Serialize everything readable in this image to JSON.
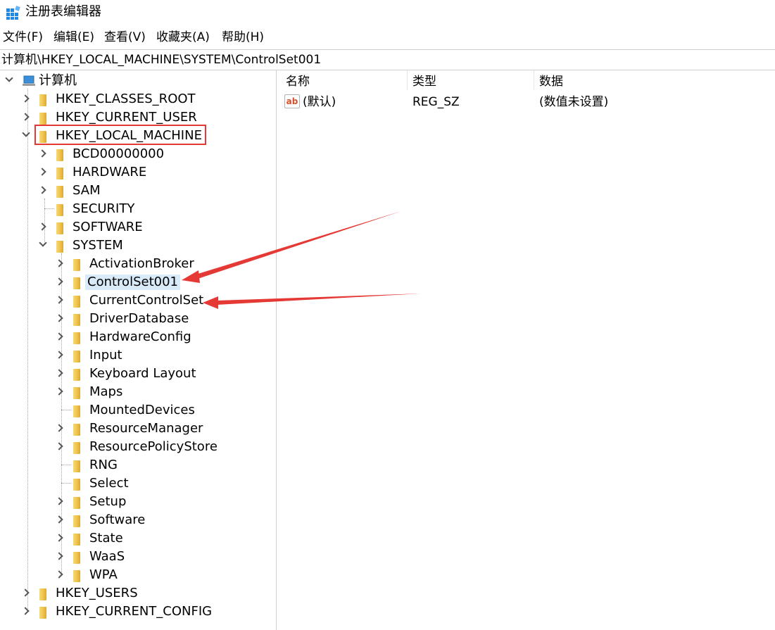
{
  "window": {
    "title": "注册表编辑器"
  },
  "menu": [
    "文件(F)",
    "编辑(E)",
    "查看(V)",
    "收藏夹(A)",
    "帮助(H)"
  ],
  "address": "计算机\\HKEY_LOCAL_MACHINE\\SYSTEM\\ControlSet001",
  "tree": {
    "root": "计算机",
    "hives": {
      "classes_root": "HKEY_CLASSES_ROOT",
      "current_user": "HKEY_CURRENT_USER",
      "local_machine": "HKEY_LOCAL_MACHINE",
      "users": "HKEY_USERS",
      "current_config": "HKEY_CURRENT_CONFIG"
    },
    "hklm_children": [
      "BCD00000000",
      "HARDWARE",
      "SAM",
      "SECURITY",
      "SOFTWARE",
      "SYSTEM"
    ],
    "system_children": [
      "ActivationBroker",
      "ControlSet001",
      "CurrentControlSet",
      "DriverDatabase",
      "HardwareConfig",
      "Input",
      "Keyboard Layout",
      "Maps",
      "MountedDevices",
      "ResourceManager",
      "ResourcePolicyStore",
      "RNG",
      "Select",
      "Setup",
      "Software",
      "State",
      "WaaS",
      "WPA"
    ],
    "selected": "ControlSet001"
  },
  "list": {
    "columns": [
      "名称",
      "类型",
      "数据"
    ],
    "rows": [
      {
        "name": "(默认)",
        "type": "REG_SZ",
        "data": "(数值未设置)",
        "icon": "string-value-icon"
      }
    ]
  },
  "colors": {
    "annotation_red": "#e53935",
    "selection": "#d9ebf9",
    "folder": "#eec04a"
  }
}
